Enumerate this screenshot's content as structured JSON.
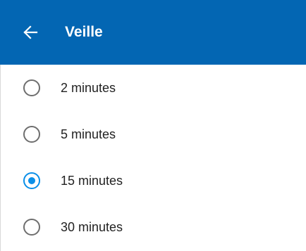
{
  "app_bar": {
    "title": "Veille",
    "back_icon": "arrow-left-icon",
    "background_color": "#0366b3"
  },
  "options": [
    {
      "label": "2 minutes",
      "selected": false
    },
    {
      "label": "5 minutes",
      "selected": false
    },
    {
      "label": "15 minutes",
      "selected": true
    },
    {
      "label": "30 minutes",
      "selected": false
    }
  ],
  "colors": {
    "radio_selected": "#0a8fe8",
    "radio_unselected": "#6e6e6e"
  }
}
